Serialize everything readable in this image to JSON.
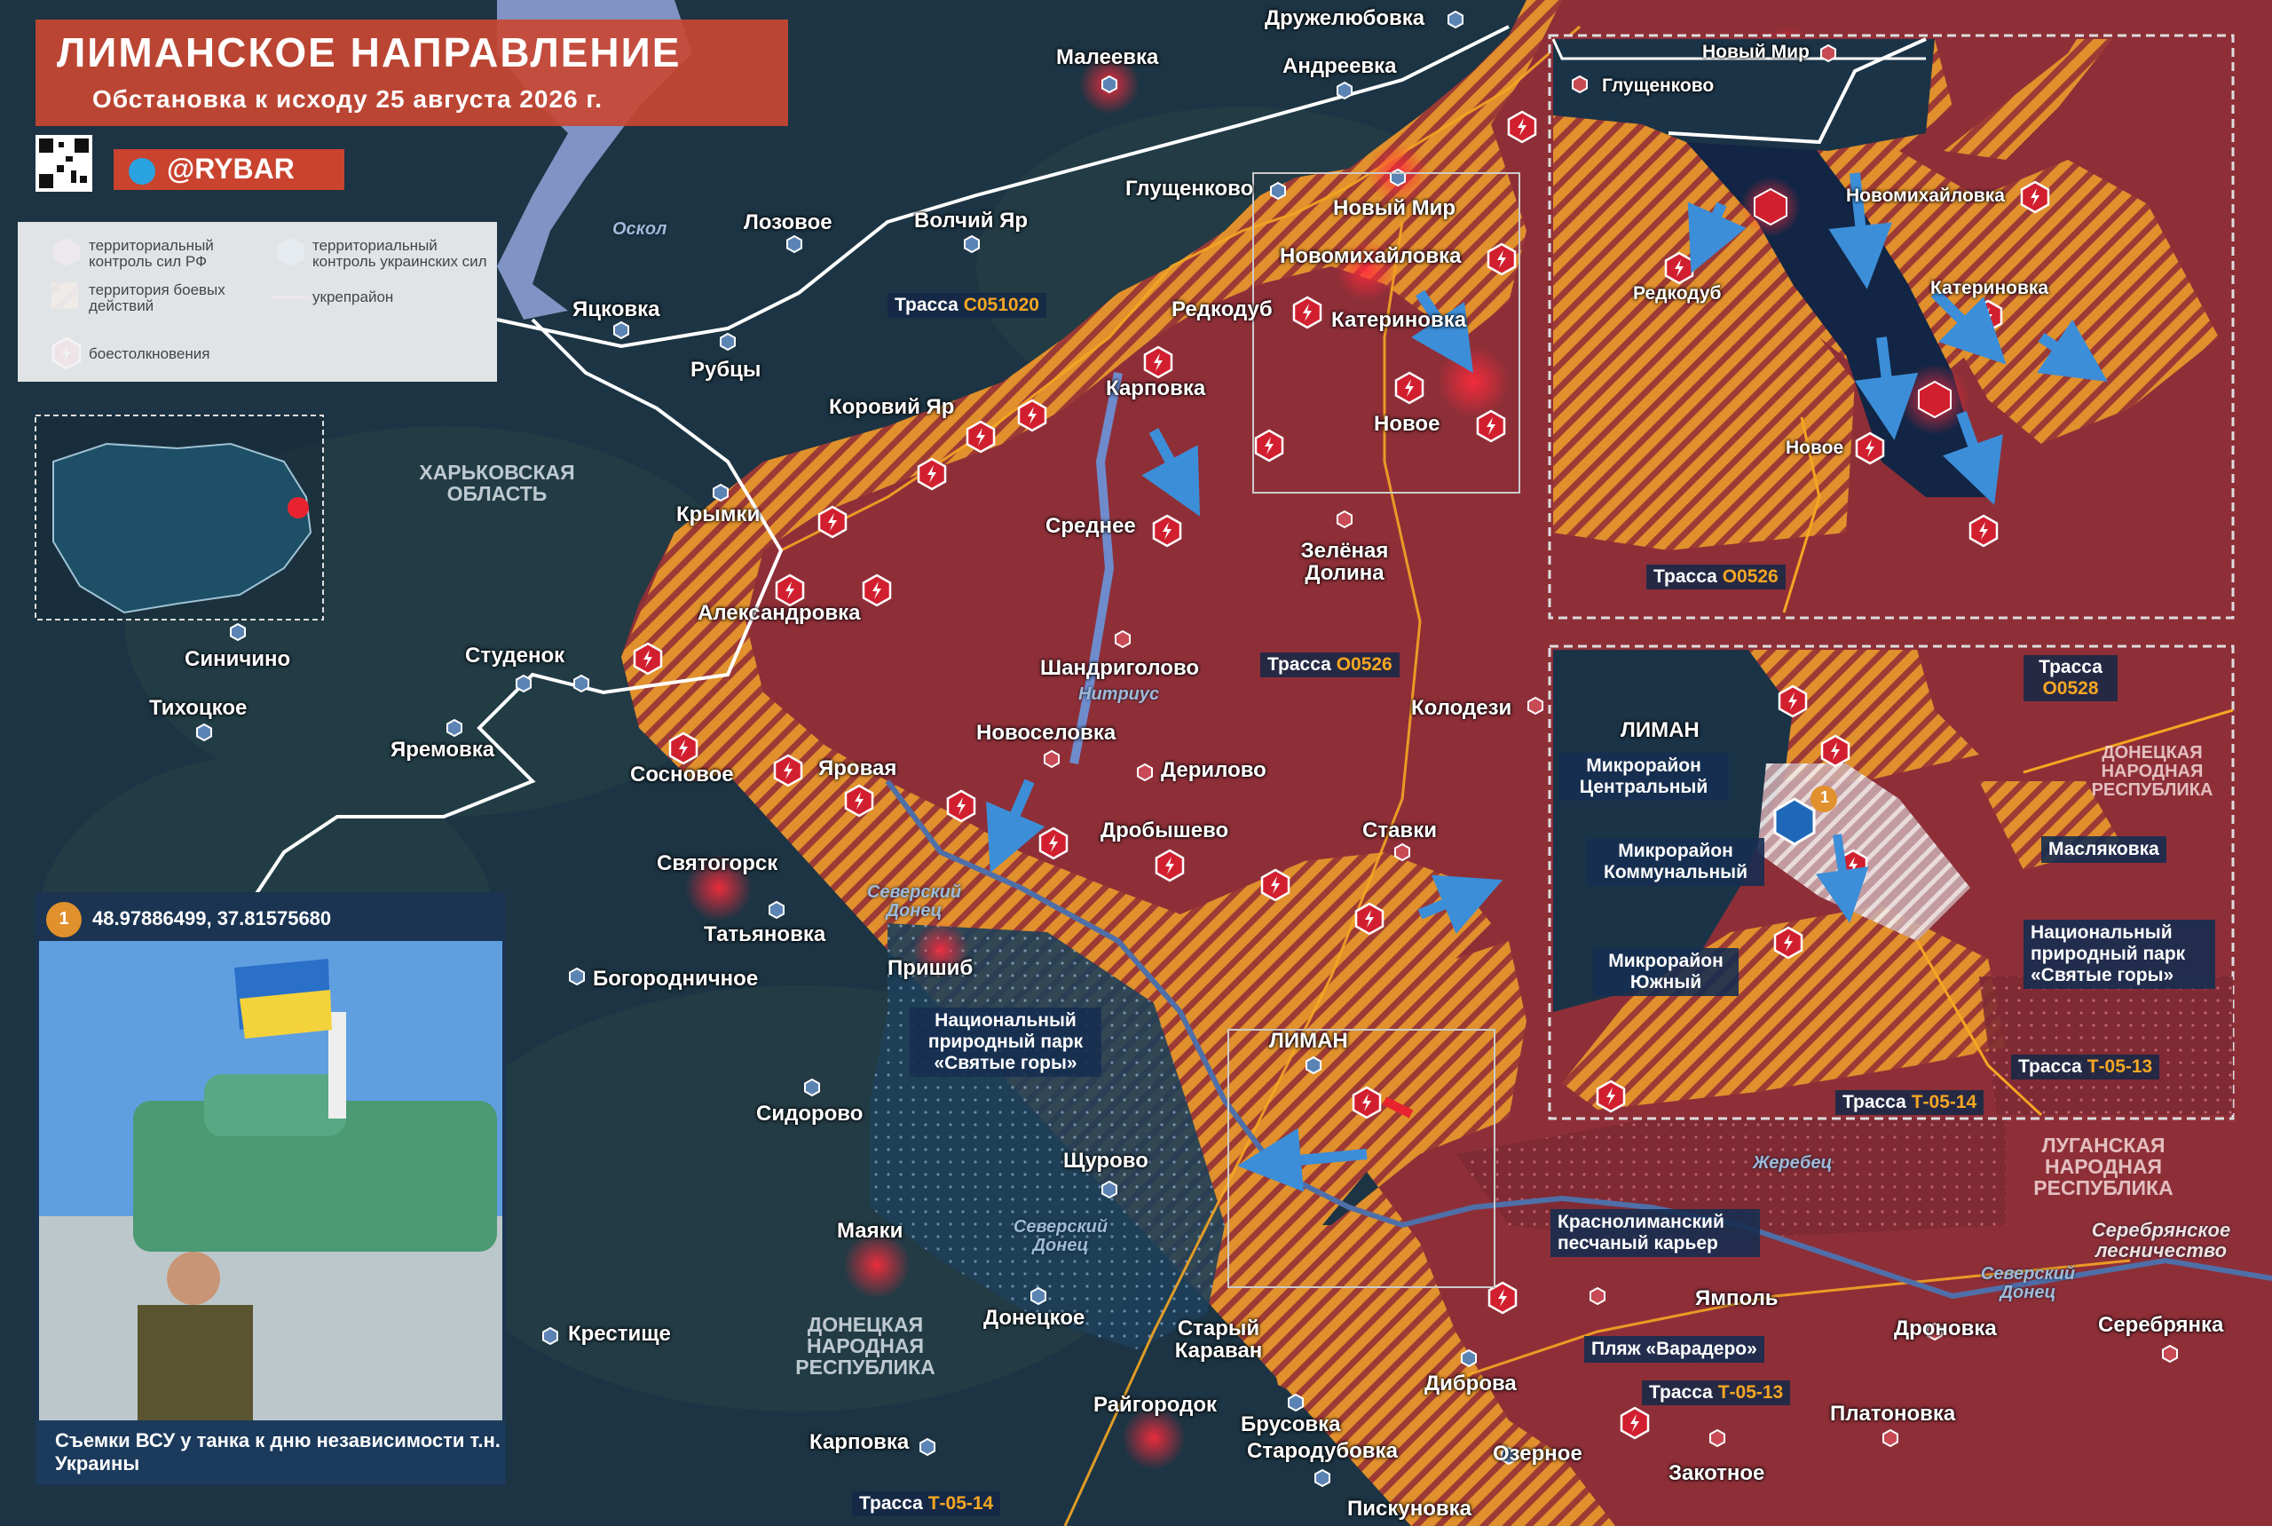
{
  "header": {
    "title": "ЛИМАНСКОЕ НАПРАВЛЕНИЕ",
    "subtitle": "Обстановка к исходу 25 августа 2026 г.",
    "brand": "@RYBAR"
  },
  "legend": {
    "ru_control": "территориальный контроль сил РФ",
    "ua_control": "территориальный контроль украинских сил",
    "combat_zone": "территория боевых действий",
    "fortified": "укрепрайон",
    "clashes": "боестолкновения"
  },
  "photo": {
    "coords": "48.97886499, 37.81575680",
    "marker": "1",
    "caption": "Съемки ВСУ у танка к дню независимости т.н. Украины"
  },
  "regions": {
    "kharkiv": "ХАРЬКОВСКАЯ ОБЛАСТЬ",
    "donetsk": "ДОНЕЦКАЯ НАРОДНАЯ РЕСПУБЛИКА",
    "donetsk_inset": "ДОНЕЦКАЯ НАРОДНАЯ РЕСПУБЛИКА",
    "luhansk": "ЛУГАНСКАЯ НАРОДНАЯ РЕСПУБЛИКА"
  },
  "rivers": {
    "oskol": "Оскол",
    "nitrius": "Нитриус",
    "donets1": "Северский Донец",
    "donets2": "Северский Донец",
    "donets3": "Северский Донец",
    "zherebets": "Жеребец"
  },
  "places": {
    "druzhelyubovka": "Дружелюбовка",
    "maleevka": "Малеевка",
    "andreevka": "Андреевка",
    "glushchenkovo": "Глущенково",
    "novyi_mir": "Новый Мир",
    "novomikhailovka": "Новомихайловка",
    "lozovoe": "Лозовое",
    "volchii_yar": "Волчий Яр",
    "yatskovka": "Яцковка",
    "rubtsy": "Рубцы",
    "redkodub": "Редкодуб",
    "katerinovka": "Катериновка",
    "karpovka": "Карповка",
    "korovii_yar": "Коровий Яр",
    "novoe": "Новое",
    "krymki": "Крымки",
    "srednee": "Среднее",
    "zelenaya_dolina": "Зелёная Долина",
    "aleksandrovka": "Александровка",
    "sinichino": "Синичино",
    "studenok": "Студенок",
    "shandrigolovo": "Шандриголово",
    "tikhotskoe": "Тихоцкое",
    "yaremovka": "Яремовка",
    "kolodezi": "Колодези",
    "novoselovka": "Новоселовка",
    "sosnovoe": "Сосновое",
    "yarovaya": "Яровая",
    "derilovo": "Дерилово",
    "drobyshevo": "Дробышево",
    "stavki": "Ставки",
    "svyatogorsk": "Святогорск",
    "tatyanovka": "Татьяновка",
    "pryshib": "Пришиб",
    "bogorodichnoe": "Богородничное",
    "liman": "ЛИМАН",
    "sidorovo": "Сидорово",
    "shchurovo": "Щурово",
    "mayaki": "Маяки",
    "krestishche": "Крестище",
    "donetskoe": "Донецкое",
    "staryi_karavan": "Старый Караван",
    "raigorodok": "Райгородок",
    "karpovka2": "Карповка",
    "brusovka": "Брусовка",
    "starodubovka": "Стародубовка",
    "dibrova": "Диброва",
    "ozernoe": "Озерное",
    "yampol": "Ямполь",
    "zakotnoe": "Закотное",
    "platonovka": "Платоновка",
    "pyskunovka": "Пискуновка",
    "dronovka": "Дроновка",
    "serebryanka": "Серебрянка",
    "serebryanskoe": "Серебрянское лесничество"
  },
  "tags": {
    "park": "Национальный природный парк «Святые горы»",
    "quarry": "Краснолиманский песчаный карьер",
    "beach": "Пляж «Варадеро»"
  },
  "roads": {
    "r1_prefix": "Трасса",
    "r1_code": "С051020",
    "r2_prefix": "Трасса",
    "r2_code": "О0526",
    "r3_prefix": "Трасса",
    "r3_code": "Т-05-13",
    "r4_prefix": "Трасса",
    "r4_code": "Т-05-14"
  },
  "inset_north": {
    "novyi_mir": "Новый Мир",
    "glushchenkovo": "Глущенково",
    "novomikhailovka": "Новомихайловка",
    "redkodub": "Редкодуб",
    "katerinovka": "Катериновка",
    "novoe": "Новое",
    "road_prefix": "Трасса",
    "road_code": "О0526"
  },
  "inset_liman": {
    "liman": "ЛИМАН",
    "mr_central": "Микрорайон Центральный",
    "mr_communal": "Микрорайон Коммунальный",
    "mr_south": "Микрорайон Южный",
    "maslyakovka": "Масляковка",
    "park": "Национальный природный парк «Святые горы»",
    "marker": "1",
    "road1_prefix": "Трасса",
    "road1_code": "О0528",
    "road2_prefix": "Трасса",
    "road2_code": "Т-05-13",
    "road3_prefix": "Трасса",
    "road3_code": "Т-05-14"
  },
  "colors": {
    "ru": "#8e2f38",
    "ua": "#1b3346",
    "combat": "#e0902c",
    "accent": "#c9432f",
    "road": "#f5a623"
  }
}
